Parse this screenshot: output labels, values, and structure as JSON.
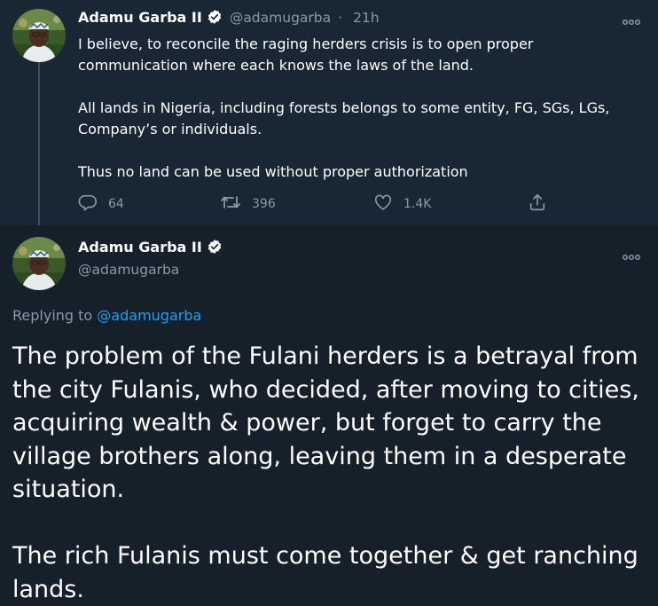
{
  "colors": {
    "background": "#15202b",
    "thread_background": "#192734",
    "text_primary": "#ffffff",
    "text_secondary": "#8899a6",
    "accent": "#1da1f2",
    "thread_line": "#3d5466"
  },
  "tweet1": {
    "author_name": "Adamu Garba II",
    "handle": "@adamugarba",
    "separator": "·",
    "time": "21h",
    "paragraphs": [
      "I believe, to reconcile the raging herders crisis is to open proper communication where each knows the laws of the land.",
      "All lands in Nigeria, including forests belongs to some entity, FG, SGs, LGs, Company’s or individuals.",
      "Thus no land can be used without proper authorization"
    ],
    "replies": "64",
    "retweets": "396",
    "likes": "1.4K",
    "icons": [
      "verified-badge-icon",
      "more-options-icon",
      "reply-icon",
      "retweet-icon",
      "like-icon",
      "share-icon"
    ]
  },
  "tweet2": {
    "author_name": "Adamu Garba II",
    "handle": "@adamugarba",
    "replying_prefix": "Replying to ",
    "replying_to": "@adamugarba",
    "paragraphs": [
      "The problem of the Fulani herders is a betrayal from the city Fulanis, who decided, after moving to cities, acquiring wealth & power, but forget to carry the village brothers along, leaving them in a desperate situation.",
      "The rich Fulanis must come together & get ranching lands."
    ],
    "icons": [
      "verified-badge-icon",
      "more-options-icon"
    ]
  }
}
